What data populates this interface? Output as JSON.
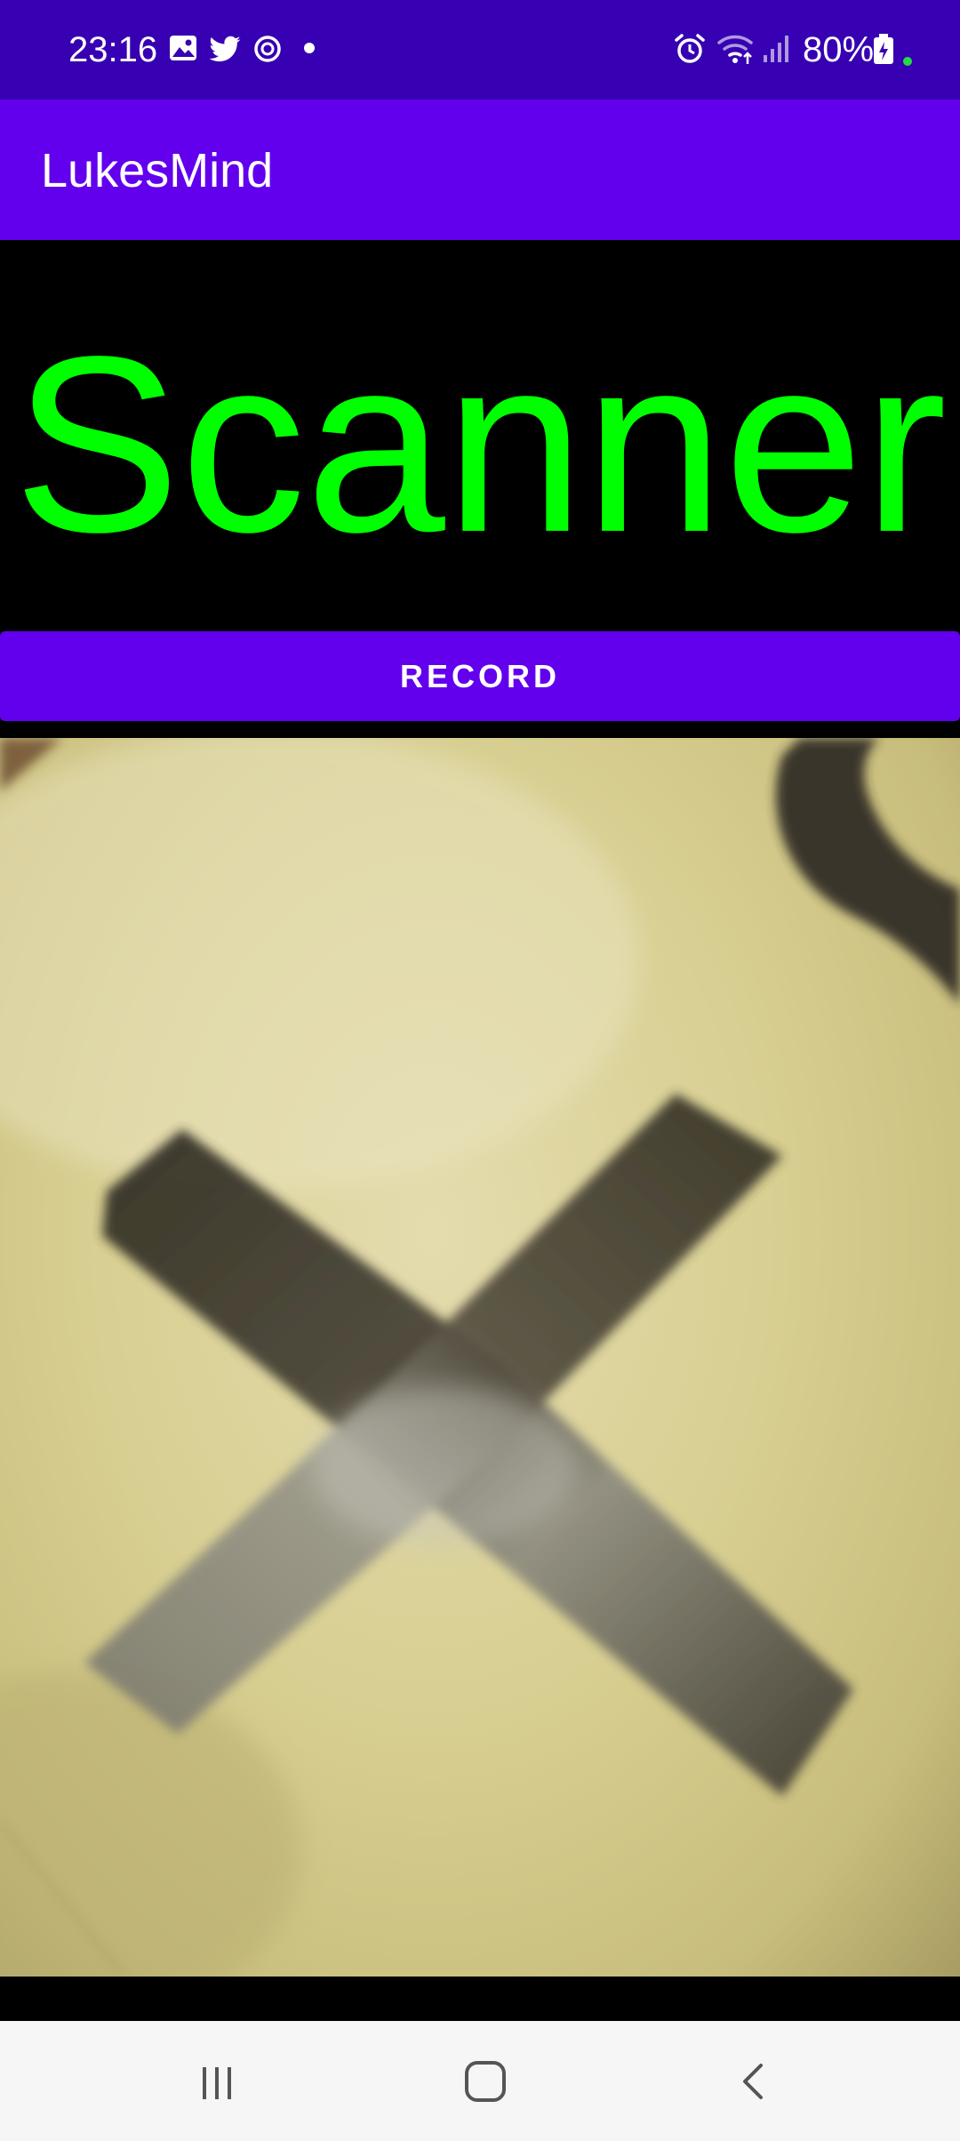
{
  "status_bar": {
    "time": "23:16",
    "battery": "80%",
    "left_icons": [
      "gallery-icon",
      "twitter-icon",
      "sync-icon",
      "dot-icon"
    ],
    "right_icons": [
      "alarm-icon",
      "wifi-icon",
      "signal-icon",
      "battery-icon"
    ],
    "background": "#3700b3"
  },
  "app_bar": {
    "title": "LukesMind",
    "background": "#6200ee"
  },
  "main": {
    "heading": "Scanner",
    "heading_color": "#00ff00",
    "record_label": "RECORD"
  },
  "nav_bar": {
    "buttons": [
      "recent-apps-icon",
      "home-icon",
      "back-icon"
    ]
  }
}
